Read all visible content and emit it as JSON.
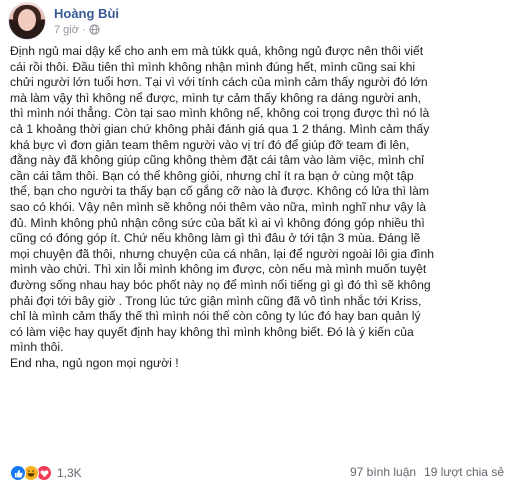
{
  "post": {
    "author": "Hoàng Bùi",
    "time": "7 giờ",
    "separator": "·",
    "privacy_icon": "globe-icon",
    "text": "Định ngủ mai dậy kể cho anh em mà túkk quá, không ngủ được nên thôi viết\ncái rồi thôi. Đầu tiên thì mình không nhận mình đúng hết, mình cũng sai khi\nchửi người lớn tuổi hơn. Tại vì với tính cách của mình cảm thấy người đó lớn\nmà làm vậy thì không nể được, mình tự cảm thấy không ra dáng người anh,\nthì mình nói thẳng. Còn tại sao mình không nể, không coi trọng được thì nó là\ncả 1 khoảng thời gian chứ không phải đánh giá qua 1 2 tháng. Mình cảm thấy\nkhá bực vì đơn giản team thêm người vào vị trí đó để giúp đỡ team đi lên,\nđằng này đã không giúp cũng không thèm đặt cái tâm vào làm việc, mình chỉ\ncần cái tâm thôi. Bạn có thể không giỏi, nhưng chỉ ít ra bạn ở cùng một tập\nthể, bạn cho người ta thấy bạn cố gắng cỡ nào là được. Không có lửa thì làm\nsao có khói. Vậy nên mình sẽ không nói thêm vào nữa, mình nghĩ như vậy là\nđủ. Mình không phủ nhận công sức của bất kì ai vì không đóng góp nhiều thì\ncũng có đóng góp ít. Chứ nếu không làm gì thì đâu ở tới tận 3 mùa. Đáng lẽ\nmọi chuyện đã thôi, nhưng chuyện của cá nhân, lại để người ngoài lôi gia đình\nmình vào chửi. Thì xin lỗi mình không im được, còn nếu mà mình muốn tuyệt\nđường sống nhau hay bóc phốt này nọ để mình nổi tiếng gì gì đó thì sẽ không\nphải đợi tới bây giờ . Trong lúc tức giận mình cũng đã vô tình nhắc tới Kriss,\nchỉ là mình cảm thấy thế thì mình nói thế còn công ty lúc đó hay ban quản lý\ncó làm việc hay quyết định hay không thì mình không biết. Đó là ý kiến của\nmình thôi.\nEnd nha, ngủ ngon mọi người !"
  },
  "footer": {
    "reaction_icons": [
      "like-icon",
      "haha-icon",
      "love-icon"
    ],
    "reaction_count": "1,3K",
    "comments": "97 bình luận",
    "shares": "19 lượt chia sẻ"
  },
  "colors": {
    "author": "#385898",
    "like": "#1877f2",
    "haha": "#f7b125",
    "love": "#f33e58",
    "muted": "#90949c"
  }
}
